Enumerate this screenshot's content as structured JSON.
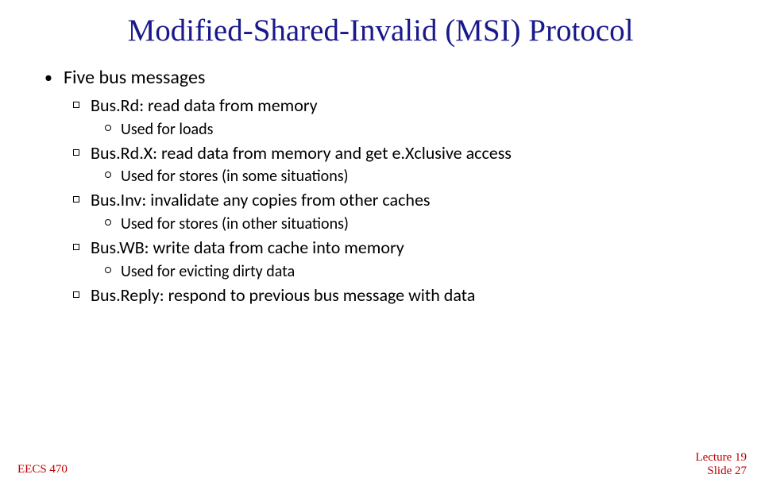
{
  "title": "Modified-Shared-Invalid (MSI) Protocol",
  "bullet1": "Five bus messages",
  "items": [
    {
      "label": "Bus.Rd: read data from memory",
      "sub": "Used for loads"
    },
    {
      "label": "Bus.Rd.X: read data from memory and get e.Xclusive access",
      "sub": "Used for stores (in some situations)"
    },
    {
      "label": "Bus.Inv: invalidate any copies from other caches",
      "sub": "Used for stores (in other situations)"
    },
    {
      "label": "Bus.WB: write data from cache into memory",
      "sub": "Used for evicting dirty data"
    },
    {
      "label": "Bus.Reply: respond to previous bus message with data",
      "sub": null
    }
  ],
  "footer": {
    "left": "EECS 470",
    "right_line1": "Lecture 19",
    "right_line2": "Slide 27"
  }
}
